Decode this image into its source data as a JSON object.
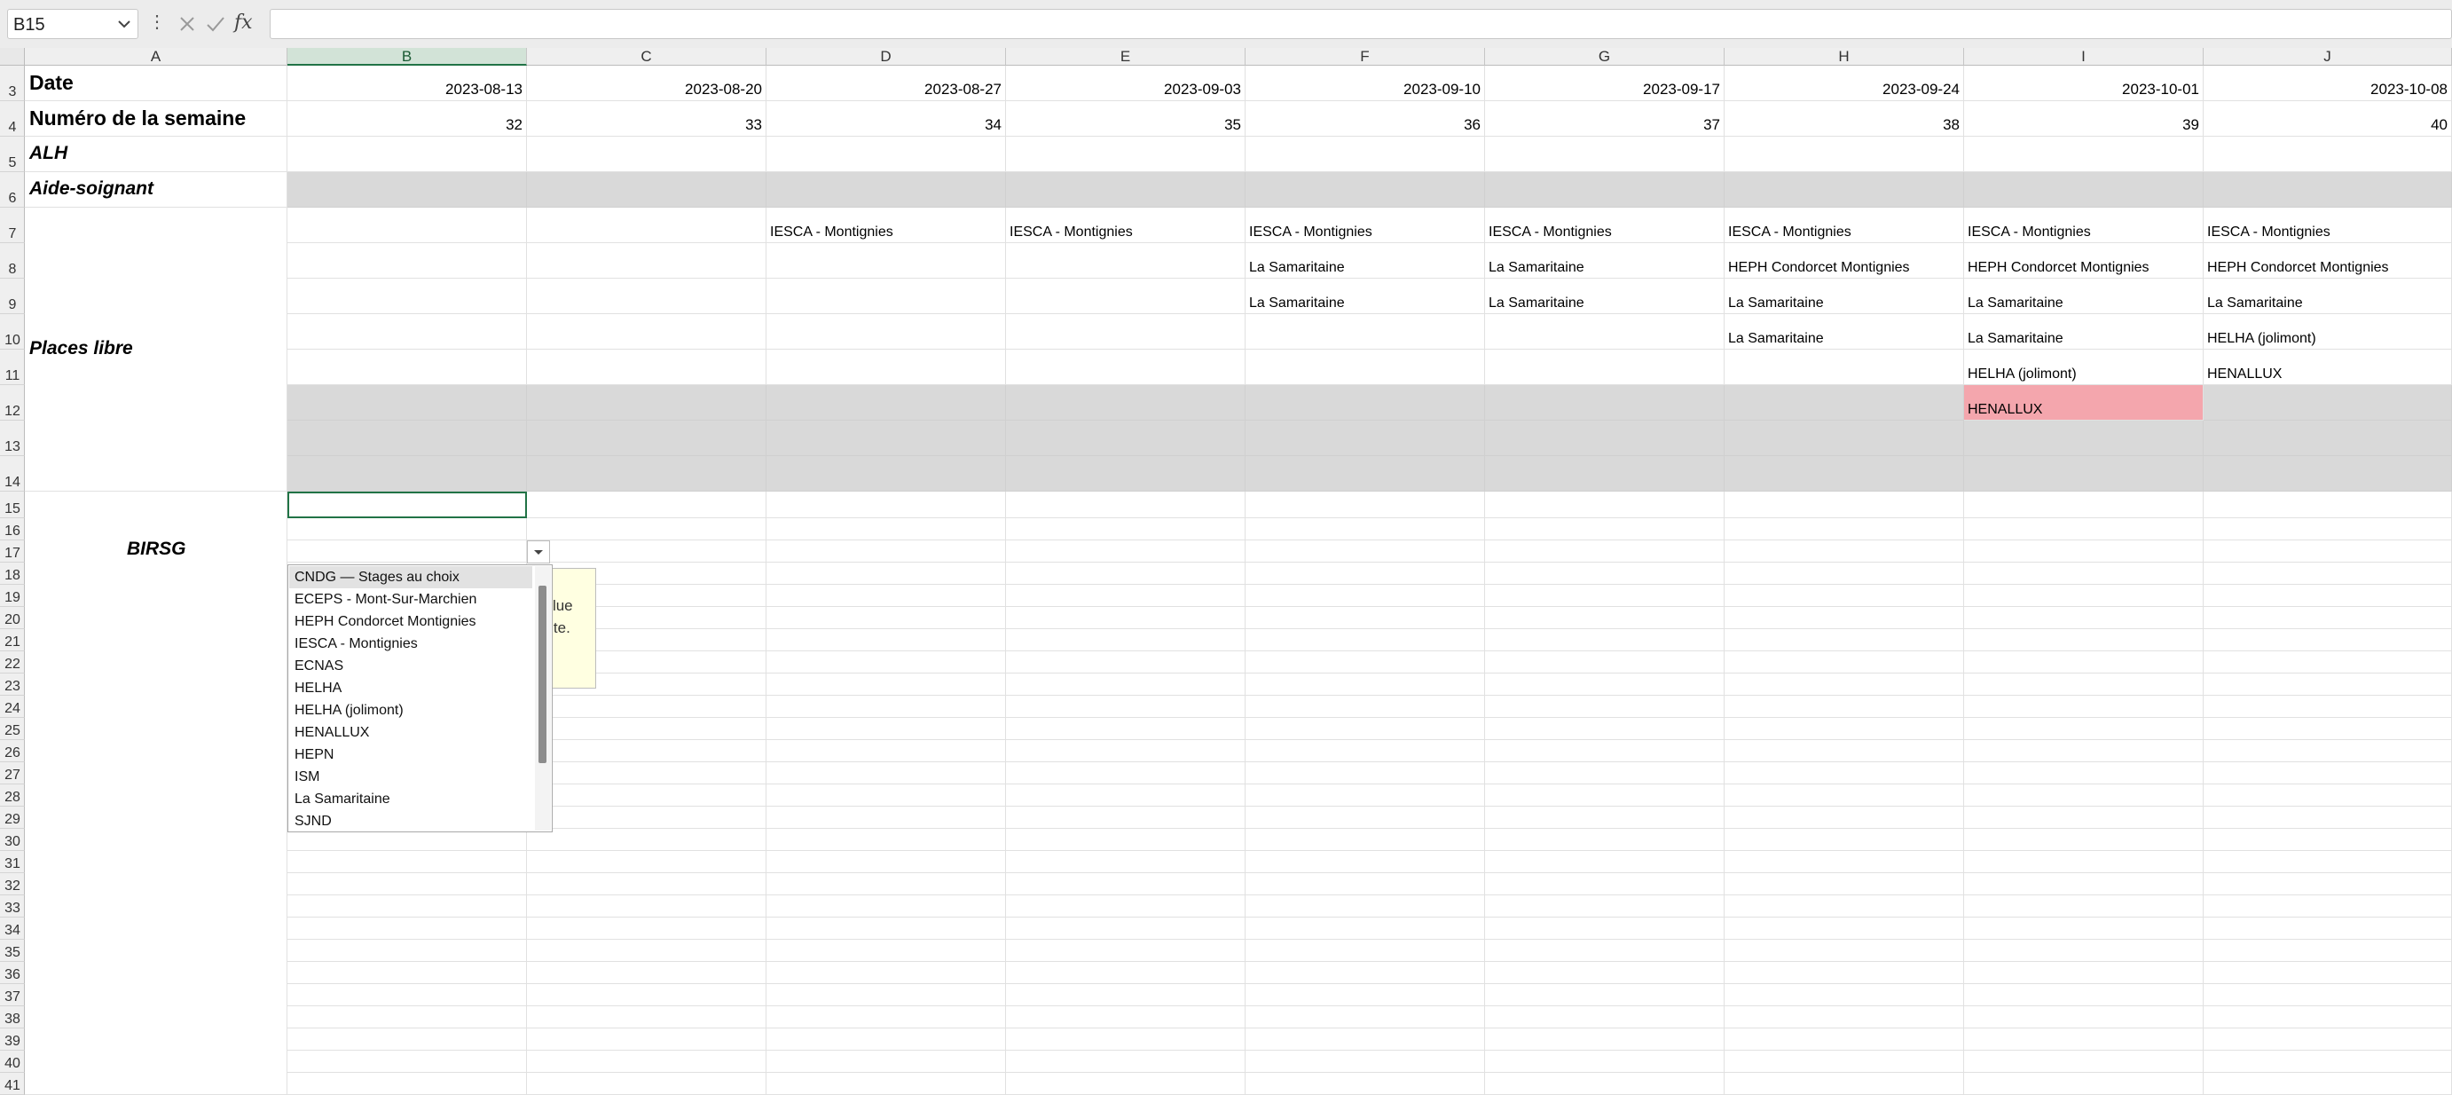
{
  "formula_bar": {
    "name_box": "B15",
    "cancel_icon": "close-icon",
    "enter_icon": "checkmark-icon",
    "function_label": "fx",
    "formula_value": ""
  },
  "columns": [
    "A",
    "B",
    "C",
    "D",
    "E",
    "F",
    "G",
    "H",
    "I",
    "J"
  ],
  "selected_column": "B",
  "rows": [
    "3",
    "4",
    "5",
    "6",
    "7",
    "8",
    "9",
    "10",
    "11",
    "12",
    "13",
    "14",
    "15",
    "16",
    "17",
    "18",
    "19",
    "20",
    "21",
    "22",
    "23",
    "24",
    "25",
    "26",
    "27",
    "28",
    "29",
    "30",
    "31",
    "32",
    "33",
    "34",
    "35",
    "36",
    "37",
    "38",
    "39",
    "40",
    "41"
  ],
  "labels": {
    "date": "Date",
    "week": "Numéro de la semaine",
    "alh": "ALH",
    "aide": "Aide-soignant",
    "places": "Places libre",
    "birsg": "BIRSG"
  },
  "dates": [
    "2023-08-13",
    "2023-08-20",
    "2023-08-27",
    "2023-09-03",
    "2023-09-10",
    "2023-09-17",
    "2023-09-24",
    "2023-10-01",
    "2023-10-08"
  ],
  "weeks": [
    "32",
    "33",
    "34",
    "35",
    "36",
    "37",
    "38",
    "39",
    "40"
  ],
  "places": {
    "r7": [
      "",
      "",
      "IESCA - Montignies",
      "IESCA - Montignies",
      "IESCA - Montignies",
      "IESCA - Montignies",
      "IESCA - Montignies",
      "IESCA - Montignies",
      "IESCA - Montignies"
    ],
    "r8": [
      "",
      "",
      "",
      "",
      "La Samaritaine",
      "La Samaritaine",
      "HEPH Condorcet Montignies",
      "HEPH Condorcet Montignies",
      "HEPH Condorcet Montignies"
    ],
    "r9": [
      "",
      "",
      "",
      "",
      "La Samaritaine",
      "La Samaritaine",
      "La Samaritaine",
      "La Samaritaine",
      "La Samaritaine"
    ],
    "r10": [
      "",
      "",
      "",
      "",
      "",
      "",
      "La Samaritaine",
      "La Samaritaine",
      "HELHA (jolimont)"
    ],
    "r11": [
      "",
      "",
      "",
      "",
      "",
      "",
      "",
      "HELHA (jolimont)",
      "HENALLUX"
    ],
    "r12": [
      "",
      "",
      "",
      "",
      "",
      "",
      "",
      "HENALLUX",
      ""
    ]
  },
  "highlight_color": "#f4a6ad",
  "dropdown": {
    "items": [
      "CNDG — Stages au choix",
      "ECEPS - Mont-Sur-Marchien",
      "HEPH Condorcet Montignies",
      "IESCA - Montignies",
      "ECNAS",
      "HELHA",
      "HELHA (jolimont)",
      "HENALLUX",
      "HEPN",
      "ISM",
      "La Samaritaine",
      "SJND"
    ]
  },
  "tooltip": {
    "line1": "e",
    "line2": "value",
    "line3": "ante."
  }
}
